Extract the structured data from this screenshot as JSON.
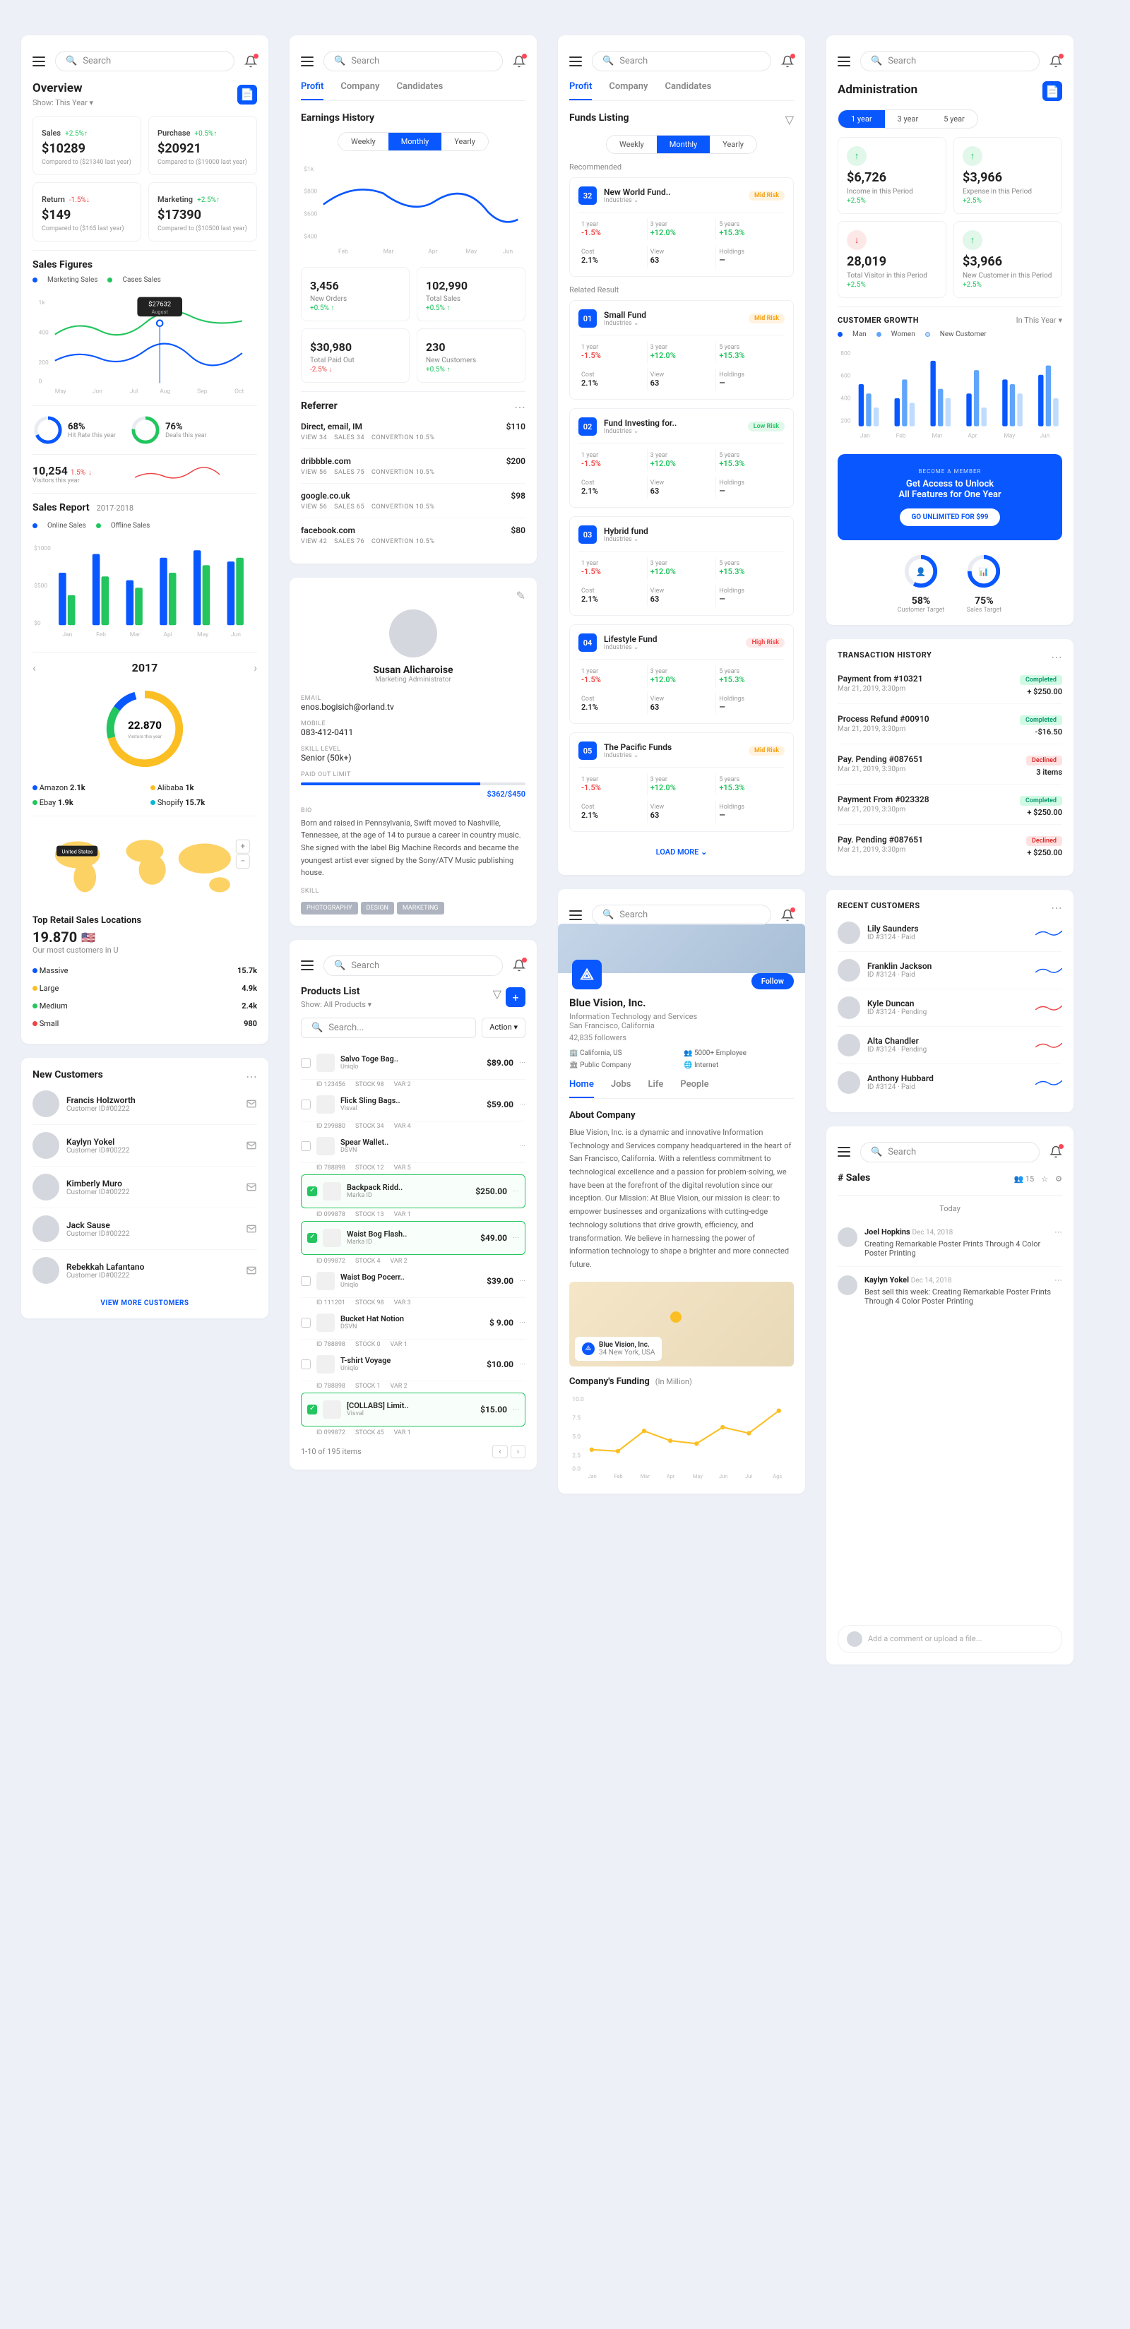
{
  "search": {
    "placeholder": "Search"
  },
  "overview": {
    "title": "Overview",
    "show": "Show: This Year",
    "stats": [
      {
        "lbl": "Sales",
        "chg": "+2.5%",
        "dir": "up",
        "val": "$10289",
        "sub": "Compared to ($21340 last year)"
      },
      {
        "lbl": "Purchase",
        "chg": "+0.5%",
        "dir": "up",
        "val": "$20921",
        "sub": "Compared to ($19000 last year)"
      },
      {
        "lbl": "Return",
        "chg": "-1.5%",
        "dir": "down",
        "val": "$149",
        "sub": "Compared to ($165 last year)"
      },
      {
        "lbl": "Marketing",
        "chg": "+2.5%",
        "dir": "up",
        "val": "$17390",
        "sub": "Compared to ($10500 last year)"
      }
    ],
    "sales_figures": {
      "title": "Sales Figures",
      "legend": [
        "Marketing Sales",
        "Cases Sales"
      ],
      "tooltip": "$27632",
      "tooltip_sub": "August",
      "months": [
        "May",
        "Jun",
        "Jul",
        "Aug",
        "Sep",
        "Oct"
      ]
    },
    "kpis": [
      {
        "val": "68%",
        "lbl": "Hit Rate this year"
      },
      {
        "val": "76%",
        "lbl": "Deals this year"
      }
    ],
    "visitors": {
      "val": "10,254",
      "chg": "1.5%",
      "lbl": "Visitors this year"
    },
    "sales_report": {
      "title": "Sales Report",
      "period": "2017-2018",
      "legend": [
        "Online Sales",
        "Offline Sales"
      ],
      "months": [
        "Jan",
        "Feb",
        "Mar",
        "Api",
        "May",
        "Jun"
      ]
    },
    "year_donut": {
      "year": "2017",
      "val": "22.870",
      "lbl": "Visitors this year",
      "items": [
        {
          "name": "Amazon",
          "val": "2.1k",
          "color": "#0957ff"
        },
        {
          "name": "Alibaba",
          "val": "1k",
          "color": "#fbbf24"
        },
        {
          "name": "Ebay",
          "val": "1.9k",
          "color": "#22c55e"
        },
        {
          "name": "Shopify",
          "val": "15.7k",
          "color": "#06b6d4"
        }
      ]
    },
    "retail": {
      "title": "Top Retail Sales Locations",
      "val": "19.870",
      "sub": "Our most customers in U",
      "rows": [
        {
          "name": "Massive",
          "val": "15.7k",
          "color": "#0957ff"
        },
        {
          "name": "Large",
          "val": "4.9k",
          "color": "#fbbf24"
        },
        {
          "name": "Medium",
          "val": "2.4k",
          "color": "#22c55e"
        },
        {
          "name": "Small",
          "val": "980",
          "color": "#ef4444"
        }
      ]
    },
    "customers": {
      "title": "New Customers",
      "items": [
        {
          "name": "Francis Holzworth",
          "id": "Customer ID#00222"
        },
        {
          "name": "Kaylyn Yokel",
          "id": "Customer ID#00222"
        },
        {
          "name": "Kimberly Muro",
          "id": "Customer ID#00222"
        },
        {
          "name": "Jack Sause",
          "id": "Customer ID#00222"
        },
        {
          "name": "Rebekkah Lafantano",
          "id": "Customer ID#00222"
        }
      ],
      "more": "VIEW MORE CUSTOMERS"
    }
  },
  "profit": {
    "tabs": [
      "Profit",
      "Company",
      "Candidates"
    ],
    "earnings": {
      "title": "Earnings History",
      "periods": [
        "Weekly",
        "Monthly",
        "Yearly"
      ],
      "months": [
        "Feb",
        "Mar",
        "Apr",
        "May",
        "Jun"
      ]
    },
    "stats": [
      {
        "val": "3,456",
        "lbl": "New Orders",
        "chg": "+0.5%",
        "dir": "up"
      },
      {
        "val": "102,990",
        "lbl": "Total Sales",
        "chg": "+0.5%",
        "dir": "up"
      },
      {
        "val": "$30,980",
        "lbl": "Total Paid Out",
        "chg": "-2.5%",
        "dir": "down"
      },
      {
        "val": "230",
        "lbl": "New Customers",
        "chg": "+0.5%",
        "dir": "up"
      }
    ],
    "referrer": {
      "title": "Referrer",
      "rows": [
        {
          "name": "Direct, email, IM",
          "val": "$110",
          "view": "34",
          "sales": "34",
          "conv": "10.5%"
        },
        {
          "name": "dribbble.com",
          "val": "$200",
          "view": "56",
          "sales": "75",
          "conv": "10.5%"
        },
        {
          "name": "google.co.uk",
          "val": "$98",
          "view": "56",
          "sales": "65",
          "conv": "10.5%"
        },
        {
          "name": "facebook.com",
          "val": "$80",
          "view": "42",
          "sales": "76",
          "conv": "10.5%"
        }
      ]
    },
    "profile": {
      "name": "Susan Alicharoise",
      "role": "Marketing Administrator",
      "email_lbl": "EMAIL",
      "email": "enos.bogisich@orland.tv",
      "mobile_lbl": "MOBILE",
      "mobile": "083-412-0411",
      "skill_lbl": "SKILL LEVEL",
      "skill": "Senior (50k+)",
      "limit_lbl": "PAID OUT LIMIT",
      "limit": "$362/$450",
      "bio_lbl": "BIO",
      "bio": "Born and raised in Pennsylvania, Swift moved to Nashville, Tennessee, at the age of 14 to pursue a career in country music. She signed with the label Big Machine Records and became the youngest artist ever signed by the Sony/ATV Music publishing house.",
      "skill_tags_lbl": "SKILL",
      "tags": [
        "PHOTOGRAPHY",
        "DESIGN",
        "MARKETING"
      ]
    }
  },
  "products": {
    "title": "Products List",
    "show": "Show: All Products",
    "search": "Search...",
    "action": "Action",
    "items": [
      {
        "sel": false,
        "name": "Salvo Toge Bag..",
        "brand": "Uniqlo",
        "price": "$89.00",
        "id": "ID 123456",
        "stock": "STOCK 98",
        "var": "VAR 2"
      },
      {
        "sel": false,
        "name": "Flick Sling Bags..",
        "brand": "Visval",
        "price": "$59.00",
        "id": "ID 299880",
        "stock": "STOCK 34",
        "var": "VAR 4"
      },
      {
        "sel": false,
        "name": "Spear Wallet..",
        "brand": "DSVN",
        "price": "",
        "id": "ID 788898",
        "stock": "STOCK 12",
        "var": "VAR 5"
      },
      {
        "sel": true,
        "name": "Backpack Ridd..",
        "brand": "Marka ID",
        "price": "$250.00",
        "id": "ID 099878",
        "stock": "STOCK 13",
        "var": "VAR 1"
      },
      {
        "sel": true,
        "name": "Waist Bog Flash..",
        "brand": "Marka ID",
        "price": "$49.00",
        "id": "ID 099872",
        "stock": "STOCK 4",
        "var": "VAR 2"
      },
      {
        "sel": false,
        "name": "Waist Bog Pocerr..",
        "brand": "Uniqlo",
        "price": "$39.00",
        "id": "ID 111201",
        "stock": "STOCK 98",
        "var": "VAR 3"
      },
      {
        "sel": false,
        "name": "Bucket Hat Notion",
        "brand": "DSVN",
        "price": "$ 9.00",
        "id": "ID 788898",
        "stock": "STOCK 0",
        "var": "VAR 1"
      },
      {
        "sel": false,
        "name": "T-shirt Voyage",
        "brand": "Uniqlo",
        "price": "$10.00",
        "id": "ID 788898",
        "stock": "STOCK 1",
        "var": "VAR 2"
      },
      {
        "sel": true,
        "name": "[COLLABS] Limit..",
        "brand": "Visval",
        "price": "$15.00",
        "id": "ID 099872",
        "stock": "STOCK 45",
        "var": "VAR 1"
      }
    ],
    "pager": "1-10 of 195 items"
  },
  "funds": {
    "tabs": [
      "Profit",
      "Company",
      "Candidates"
    ],
    "title": "Funds Listing",
    "periods": [
      "Weekly",
      "Monthly",
      "Yearly"
    ],
    "rec": "Recommended",
    "rel": "Related Result",
    "loadmore": "LOAD MORE",
    "items": [
      {
        "num": "32",
        "name": "New World Fund..",
        "ind": "Industries",
        "risk": "Mid Risk",
        "riskc": "risk-mid"
      },
      {
        "num": "01",
        "name": "Small Fund",
        "ind": "Industries",
        "risk": "Mid Risk",
        "riskc": "risk-mid"
      },
      {
        "num": "02",
        "name": "Fund Investing for..",
        "ind": "Industries",
        "risk": "Low Risk",
        "riskc": "risk-low"
      },
      {
        "num": "03",
        "name": "Hybrid fund",
        "ind": "Industries",
        "risk": "",
        "riskc": ""
      },
      {
        "num": "04",
        "name": "Lifestyle Fund",
        "ind": "Industries",
        "risk": "High Risk",
        "riskc": "risk-high"
      },
      {
        "num": "05",
        "name": "The Pacific Funds",
        "ind": "Industries",
        "risk": "Mid Risk",
        "riskc": "risk-mid"
      }
    ],
    "cols": [
      {
        "lbl": "1 year",
        "val": "-1.5%",
        "cls": "down"
      },
      {
        "lbl": "3 year",
        "val": "+12.0%",
        "cls": "up"
      },
      {
        "lbl": "5 years",
        "val": "+15.3%",
        "cls": "up"
      }
    ],
    "cols2": [
      {
        "lbl": "Cost",
        "val": "2.1%"
      },
      {
        "lbl": "View",
        "val": "63"
      },
      {
        "lbl": "Holdings",
        "val": "—"
      }
    ]
  },
  "company": {
    "name": "Blue Vision, Inc.",
    "follow": "Follow",
    "meta": [
      "Information Technology and Services",
      "San Francisco, California",
      "42,835 followers"
    ],
    "facts": [
      "California, US",
      "5000+ Employee",
      "Public Company",
      "Internet"
    ],
    "tabs": [
      "Home",
      "Jobs",
      "Life",
      "People"
    ],
    "about_title": "About Company",
    "about": "Blue Vision, Inc. is a dynamic and innovative Information Technology and Services company headquartered in the heart of San Francisco, California. With a relentless commitment to technological excellence and a passion for problem-solving, we have been at the forefront of the digital revolution since our inception. Our Mission: At Blue Vision, our mission is clear: to empower businesses and organizations with cutting-edge technology solutions that drive growth, efficiency, and transformation. We believe in harnessing the power of information technology to shape a brighter and more connected future.",
    "map": {
      "name": "Blue Vision, Inc.",
      "addr": "34 New York, USA"
    },
    "funding": {
      "title": "Company's Funding",
      "unit": "(In Million)",
      "months": [
        "Jan",
        "Feb",
        "Mar",
        "Apr",
        "May",
        "Jun",
        "Jul",
        "Ags"
      ]
    }
  },
  "admin": {
    "title": "Administration",
    "periods": [
      "1 year",
      "3 year",
      "5 year"
    ],
    "stats": [
      {
        "val": "$6,726",
        "lbl": "Income in this Period",
        "chg": "+2.5%",
        "dir": "up",
        "ic": "up"
      },
      {
        "val": "$3,966",
        "lbl": "Expense in this Period",
        "chg": "+2.5%",
        "dir": "up",
        "ic": "up"
      },
      {
        "val": "28,019",
        "lbl": "Total Visitor in this Period",
        "chg": "+2.5%",
        "dir": "up",
        "ic": "down"
      },
      {
        "val": "$3,966",
        "lbl": "New Customer in this Period",
        "chg": "+2.5%",
        "dir": "up",
        "ic": "up"
      }
    ],
    "growth": {
      "title": "CUSTOMER GROWTH",
      "period": "In This Year",
      "legend": [
        "Man",
        "Women",
        "New Customer"
      ],
      "months": [
        "Jan",
        "Feb",
        "Mar",
        "Apr",
        "May",
        "Jun"
      ]
    },
    "promo": {
      "tag": "BECOME A MEMBER",
      "line1": "Get Access to Unlock",
      "line2": "All Features for One Year",
      "btn": "GO UNLIMITED FOR $99"
    },
    "targets": [
      {
        "val": "58%",
        "lbl": "Customer Target"
      },
      {
        "val": "75%",
        "lbl": "Sales Target"
      }
    ],
    "txn": {
      "title": "TRANSACTION HISTORY",
      "rows": [
        {
          "name": "Payment from #10321",
          "date": "Mar 21, 2019, 3:30pm",
          "amt": "+ $250.00",
          "st": "Completed",
          "stc": "badge-ok"
        },
        {
          "name": "Process Refund #00910",
          "date": "Mar 21, 2019, 3:30pm",
          "amt": "-$16.50",
          "st": "Completed",
          "stc": "badge-ok"
        },
        {
          "name": "Pay. Pending #087651",
          "date": "Mar 21, 2019, 3:30pm",
          "amt": "3 items",
          "st": "Declined",
          "stc": "badge-dec"
        },
        {
          "name": "Payment From #023328",
          "date": "Mar 21, 2019, 3:30pm",
          "amt": "+ $250.00",
          "st": "Completed",
          "stc": "badge-ok"
        },
        {
          "name": "Pay. Pending #087651",
          "date": "Mar 21, 2019, 3:30pm",
          "amt": "+ $250.00",
          "st": "Declined",
          "stc": "badge-dec"
        }
      ]
    },
    "recent": {
      "title": "RECENT CUSTOMERS",
      "rows": [
        {
          "name": "Lily Saunders",
          "id": "ID #3124 · Paid",
          "color": "#0957ff"
        },
        {
          "name": "Franklin Jackson",
          "id": "ID #3124 · Paid",
          "color": "#0957ff"
        },
        {
          "name": "Kyle Duncan",
          "id": "ID #3124 · Pending",
          "color": "#ef4444"
        },
        {
          "name": "Alta Chandler",
          "id": "ID #3124 · Pending",
          "color": "#ef4444"
        },
        {
          "name": "Anthony Hubbard",
          "id": "ID #3124 · Paid",
          "color": "#0957ff"
        }
      ]
    }
  },
  "sales": {
    "title": "# Sales",
    "count": "15",
    "today": "Today",
    "feed": [
      {
        "name": "Joel Hopkins",
        "date": "Dec 14, 2018",
        "text": "Creating Remarkable Poster Prints Through 4 Color Poster Printing"
      },
      {
        "name": "Kaylyn Yokel",
        "date": "Dec 14, 2018",
        "text": "Best sell this week: Creating Remarkable Poster Prints Through 4 Color Poster Printing"
      }
    ],
    "comment": "Add a comment or upload a file..."
  },
  "chart_data": [
    {
      "type": "line",
      "id": "sales_figures",
      "categories": [
        "May",
        "Jun",
        "Jul",
        "Aug",
        "Sep",
        "Oct"
      ],
      "series": [
        {
          "name": "Marketing Sales",
          "values": [
            200,
            300,
            250,
            276,
            310,
            280
          ]
        },
        {
          "name": "Cases Sales",
          "values": [
            400,
            500,
            420,
            480,
            520,
            505
          ]
        }
      ],
      "ylim": [
        0,
        1000
      ]
    },
    {
      "type": "bar",
      "id": "sales_report",
      "categories": [
        "Jan",
        "Feb",
        "Mar",
        "Api",
        "May",
        "Jun"
      ],
      "series": [
        {
          "name": "Online Sales",
          "values": [
            700,
            950,
            600,
            900,
            1000,
            850
          ]
        },
        {
          "name": "Offline Sales",
          "values": [
            400,
            650,
            500,
            700,
            800,
            900
          ]
        }
      ],
      "ylim": [
        0,
        1000
      ]
    },
    {
      "type": "pie",
      "id": "year_donut",
      "categories": [
        "Amazon",
        "Alibaba",
        "Ebay",
        "Shopify"
      ],
      "values": [
        2100,
        1000,
        1900,
        15700
      ],
      "title": "22.870"
    },
    {
      "type": "line",
      "id": "earnings",
      "categories": [
        "Feb",
        "Mar",
        "Apr",
        "May",
        "Jun"
      ],
      "values": [
        650,
        800,
        550,
        700,
        500
      ],
      "ylim": [
        0,
        1000
      ]
    },
    {
      "type": "bar",
      "id": "customer_growth",
      "categories": [
        "Jan",
        "Feb",
        "Mar",
        "Apr",
        "May",
        "Jun"
      ],
      "series": [
        {
          "name": "Man",
          "values": [
            450,
            300,
            700,
            350,
            500,
            550
          ]
        },
        {
          "name": "Women",
          "values": [
            350,
            500,
            400,
            600,
            450,
            650
          ]
        },
        {
          "name": "New Customer",
          "values": [
            200,
            250,
            300,
            200,
            350,
            300
          ]
        }
      ],
      "ylim": [
        0,
        800
      ]
    },
    {
      "type": "line",
      "id": "company_funding",
      "categories": [
        "Jan",
        "Feb",
        "Mar",
        "Apr",
        "May",
        "Jun",
        "Jul",
        "Ags"
      ],
      "values": [
        3.0,
        2.8,
        5.5,
        4.0,
        3.5,
        6.0,
        5.0,
        8.0
      ],
      "ylim": [
        0,
        10
      ]
    }
  ]
}
